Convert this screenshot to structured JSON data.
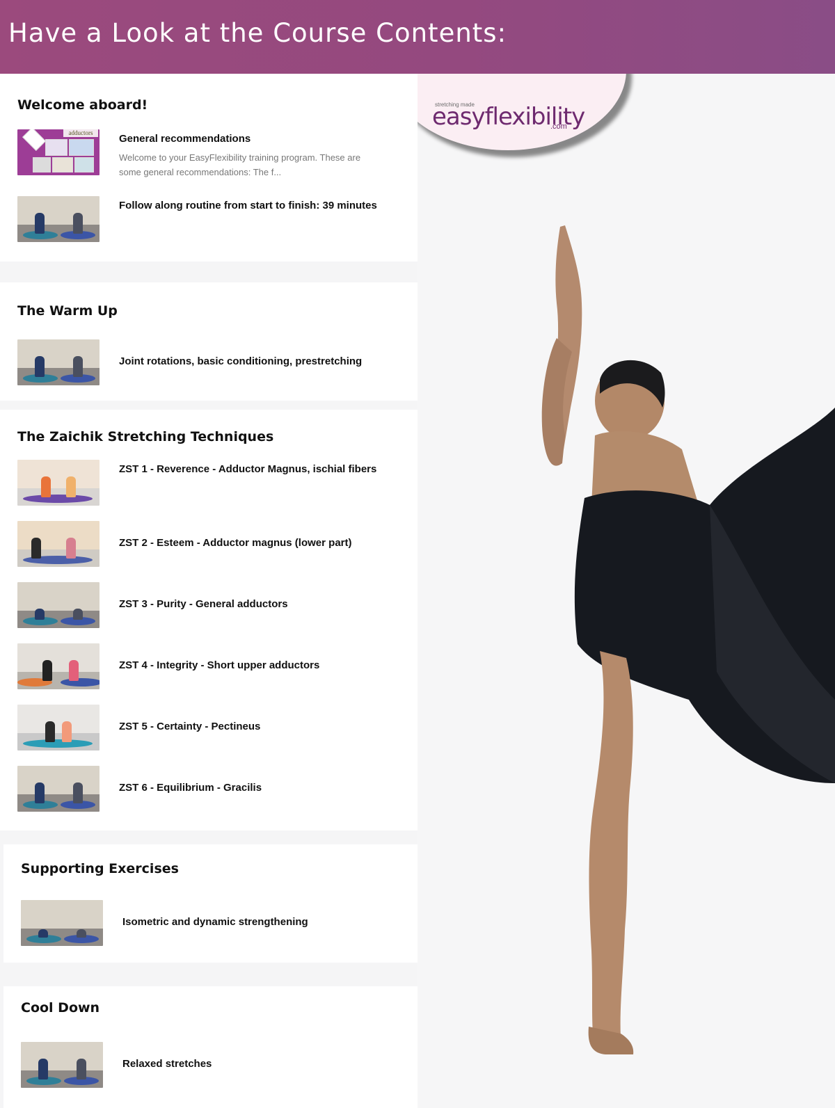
{
  "header": {
    "title": "Have a Look at the Course Contents:"
  },
  "logo": {
    "tagline": "stretching made",
    "wordmark": "easyflexibility",
    "domain": ".com"
  },
  "sections": [
    {
      "title": "Welcome aboard!",
      "items": [
        {
          "title": "General recommendations",
          "description": "Welcome to your EasyFlexibility training program. These are some general recommendations: The f...",
          "thumb_label": "adductors"
        },
        {
          "title": "Follow along routine from start to finish: 39 minutes"
        }
      ]
    },
    {
      "title": "The Warm Up",
      "items": [
        {
          "title": "Joint rotations, basic conditioning, prestretching"
        }
      ]
    },
    {
      "title": "The Zaichik Stretching Techniques",
      "items": [
        {
          "title": "ZST 1 - Reverence - Adductor Magnus, ischial fibers"
        },
        {
          "title": "ZST 2 - Esteem - Adductor magnus (lower part)"
        },
        {
          "title": "ZST 3 - Purity - General adductors"
        },
        {
          "title": "ZST 4 - Integrity - Short upper adductors"
        },
        {
          "title": "ZST 5 - Certainty - Pectineus"
        },
        {
          "title": "ZST 6 - Equilibrium - Gracilis"
        }
      ]
    },
    {
      "title": "Supporting Exercises",
      "items": [
        {
          "title": "Isometric and dynamic strengthening"
        }
      ]
    },
    {
      "title": "Cool Down",
      "items": [
        {
          "title": "Relaxed stretches"
        }
      ]
    }
  ],
  "colors": {
    "header": "#98497f",
    "logo": "#6e2a6f",
    "dress": "#16191f"
  }
}
